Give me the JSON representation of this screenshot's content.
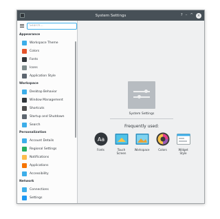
{
  "window": {
    "title": "System Settings",
    "help_glyph": "?",
    "minimize_glyph": "–",
    "maximize_glyph": "^",
    "close_glyph": "×"
  },
  "search": {
    "placeholder": "Search..."
  },
  "sidebar": {
    "sections": [
      {
        "header": "Appearance",
        "items": [
          {
            "label": "Workspace Theme",
            "icon": "workspace-theme-icon",
            "color": "#3daee9"
          },
          {
            "label": "Colors",
            "icon": "colors-icon",
            "color": "#e5542c"
          },
          {
            "label": "Fonts",
            "icon": "fonts-icon",
            "color": "#31363b"
          },
          {
            "label": "Icons",
            "icon": "icons-icon",
            "color": "#7f8c8d"
          },
          {
            "label": "Application Style",
            "icon": "application-style-icon",
            "color": "#5d6670"
          }
        ]
      },
      {
        "header": "Workspace",
        "items": [
          {
            "label": "Desktop Behavior",
            "icon": "desktop-behavior-icon",
            "color": "#3daee9"
          },
          {
            "label": "Window Management",
            "icon": "window-management-icon",
            "color": "#31363b"
          },
          {
            "label": "Shortcuts",
            "icon": "shortcuts-icon",
            "color": "#4d4d4d"
          },
          {
            "label": "Startup and Shutdown",
            "icon": "startup-shutdown-icon",
            "color": "#5d6670"
          },
          {
            "label": "Search",
            "icon": "search-icon",
            "color": "#3daee9"
          }
        ]
      },
      {
        "header": "Personalization",
        "items": [
          {
            "label": "Account Details",
            "icon": "account-details-icon",
            "color": "#3daee9"
          },
          {
            "label": "Regional Settings",
            "icon": "regional-settings-icon",
            "color": "#27ae60"
          },
          {
            "label": "Notifications",
            "icon": "notifications-icon",
            "color": "#fdbc4b"
          },
          {
            "label": "Applications",
            "icon": "applications-icon",
            "color": "#f67400"
          },
          {
            "label": "Accessibility",
            "icon": "accessibility-icon",
            "color": "#3daee9"
          }
        ]
      },
      {
        "header": "Network",
        "items": [
          {
            "label": "Connections",
            "icon": "connections-icon",
            "color": "#3daee9"
          },
          {
            "label": "Settings",
            "icon": "network-settings-icon",
            "color": "#1d99f3"
          }
        ]
      }
    ]
  },
  "main": {
    "hero_label": "System Settings",
    "frequently_used_title": "Frequently used:",
    "frequent": [
      {
        "label": "Fonts",
        "icon": "fonts-icon",
        "glyph": "Aa"
      },
      {
        "label": "Touch\nScreen",
        "icon": "touch-screen-icon"
      },
      {
        "label": "Workspace",
        "icon": "workspace-icon"
      },
      {
        "label": "Colors",
        "icon": "colors-icon"
      },
      {
        "label": "Widget\nStyle",
        "icon": "widget-style-icon"
      }
    ]
  }
}
